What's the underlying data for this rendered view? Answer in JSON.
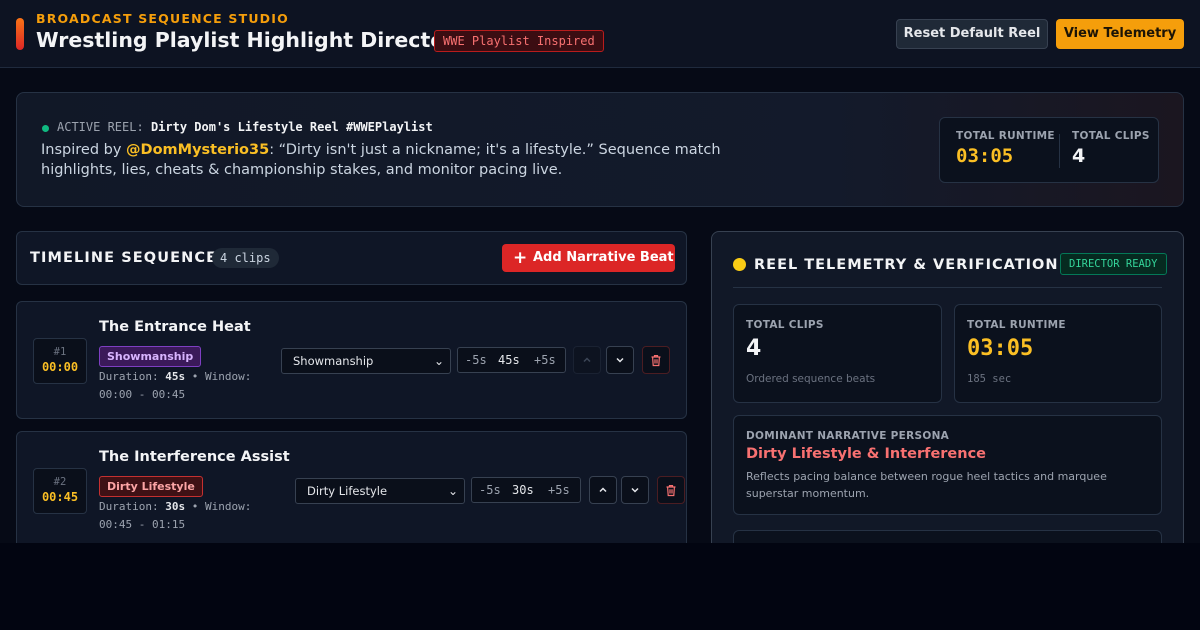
{
  "header": {
    "kicker": "BROADCAST SEQUENCE STUDIO",
    "title": "Wrestling Playlist Highlight Director",
    "badge": "WWE Playlist Inspired",
    "reset_label": "Reset Default Reel",
    "telemetry_label": "View Telemetry"
  },
  "banner": {
    "reel_prefix": "ACTIVE REEL:",
    "reel_name": "Dirty Dom's Lifestyle Reel #WWEPlaylist",
    "desc_prefix": "Inspired by ",
    "handle": "@DomMysterio35",
    "desc_rest": ": “Dirty isn't just a nickname; it's a lifestyle.” Sequence match highlights, lies, cheats & championship stakes, and monitor pacing live.",
    "runtime_label": "TOTAL RUNTIME",
    "runtime_value": "03:05",
    "clips_label": "TOTAL CLIPS",
    "clips_value": "4"
  },
  "timeline": {
    "title": "TIMELINE SEQUENCE",
    "count": "4 clips",
    "add_label": "Add Narrative Beat",
    "add_icon": "plus-icon"
  },
  "clips": [
    {
      "index": "#1",
      "start": "00:00",
      "title": "The Entrance Heat",
      "tag": "Showmanship",
      "duration_label": "Duration:",
      "duration": "45s",
      "window_label": "• Window:",
      "window": "00:00 - 00:45",
      "select_value": "Showmanship",
      "minus": "-5s",
      "dur_display": "45s",
      "plus": "+5s",
      "move_up_disabled": true
    },
    {
      "index": "#2",
      "start": "00:45",
      "title": "The Interference Assist",
      "tag": "Dirty Lifestyle",
      "duration_label": "Duration:",
      "duration": "30s",
      "window_label": "• Window:",
      "window": "00:45 - 01:15",
      "select_value": "Dirty Lifestyle",
      "minus": "-5s",
      "dur_display": "30s",
      "plus": "+5s",
      "move_up_disabled": false
    }
  ],
  "telemetry": {
    "title": "REEL TELEMETRY & VERIFICATION",
    "status": "DIRECTOR READY",
    "clips_label": "TOTAL CLIPS",
    "clips_value": "4",
    "clips_sub": "Ordered sequence beats",
    "runtime_label": "TOTAL RUNTIME",
    "runtime_value": "03:05",
    "runtime_sub": "185 sec",
    "persona_label": "DOMINANT NARRATIVE PERSONA",
    "persona_value": "Dirty Lifestyle & Interference",
    "persona_desc": "Reflects pacing balance between rogue heel tactics and marquee superstar momentum."
  },
  "colors": {
    "accent": "#f59e0b",
    "danger": "#dc2626",
    "showmanship": "#d8b4fe",
    "dirty": "#fca5a5",
    "ready": "#34d399"
  }
}
